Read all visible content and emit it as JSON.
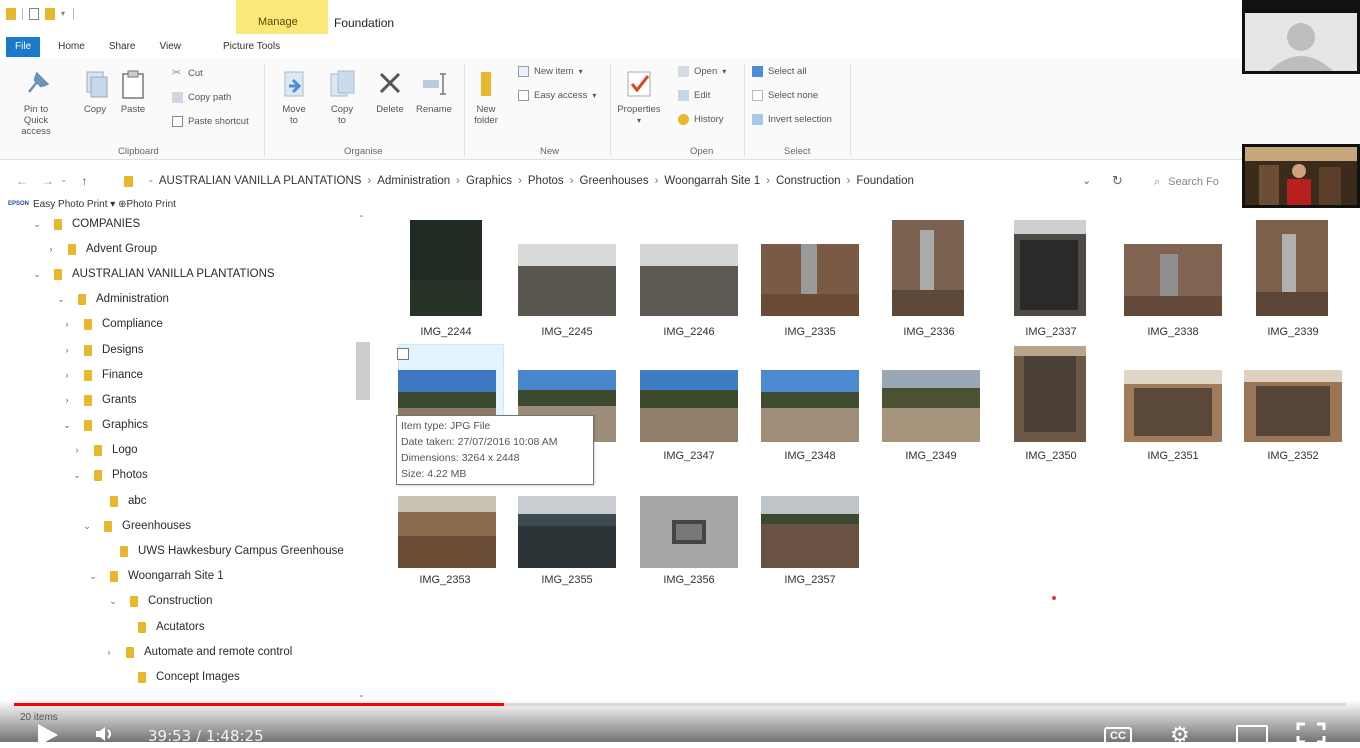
{
  "window": {
    "manage_tab": "Manage",
    "title": "Foundation"
  },
  "tabs": [
    "File",
    "Home",
    "Share",
    "View",
    "Picture Tools"
  ],
  "ribbon": {
    "clipboard": {
      "pin": "Pin to Quick access",
      "copy": "Copy",
      "paste": "Paste",
      "cut": "Cut",
      "copy_path": "Copy path",
      "paste_shortcut": "Paste shortcut",
      "label": "Clipboard"
    },
    "organise": {
      "move_to": "Move to",
      "copy_to": "Copy to",
      "delete": "Delete",
      "rename": "Rename",
      "label": "Organise"
    },
    "new": {
      "new_folder": "New folder",
      "new_item": "New item",
      "easy_access": "Easy access",
      "label": "New"
    },
    "open": {
      "properties": "Properties",
      "open": "Open",
      "edit": "Edit",
      "history": "History",
      "label": "Open"
    },
    "select": {
      "select_all": "Select all",
      "select_none": "Select none",
      "invert": "Invert selection",
      "label": "Select"
    }
  },
  "address": {
    "crumbs": [
      "AUSTRALIAN VANILLA PLANTATIONS",
      "Administration",
      "Graphics",
      "Photos",
      "Greenhouses",
      "Woongarrah Site 1",
      "Construction",
      "Foundation"
    ],
    "search_placeholder": "Search Fo"
  },
  "favorites_bar": {
    "brand": "EPSON",
    "text": "Easy Photo Print ▾ ⊕Photo Print"
  },
  "tree": [
    {
      "label": "COMPANIES",
      "toggle": "⌄"
    },
    {
      "label": "Advent Group",
      "toggle": "›"
    },
    {
      "label": "AUSTRALIAN VANILLA PLANTATIONS",
      "toggle": "⌄"
    },
    {
      "label": "Administration",
      "toggle": "⌄"
    },
    {
      "label": "Compliance",
      "toggle": "›"
    },
    {
      "label": "Designs",
      "toggle": "›"
    },
    {
      "label": "Finance",
      "toggle": "›"
    },
    {
      "label": "Grants",
      "toggle": "›"
    },
    {
      "label": "Graphics",
      "toggle": "⌄"
    },
    {
      "label": "Logo",
      "toggle": "›"
    },
    {
      "label": "Photos",
      "toggle": "⌄"
    },
    {
      "label": "abc",
      "toggle": ""
    },
    {
      "label": "Greenhouses",
      "toggle": "⌄"
    },
    {
      "label": "UWS Hawkesbury Campus Greenhouse",
      "toggle": ""
    },
    {
      "label": "Woongarrah Site 1",
      "toggle": "⌄"
    },
    {
      "label": "Construction",
      "toggle": "⌄"
    },
    {
      "label": "Acutators",
      "toggle": ""
    },
    {
      "label": "Automate and remote control",
      "toggle": "›"
    },
    {
      "label": "Concept Images",
      "toggle": ""
    }
  ],
  "files": [
    {
      "name": "IMG_2244"
    },
    {
      "name": "IMG_2245"
    },
    {
      "name": "IMG_2246"
    },
    {
      "name": "IMG_2335"
    },
    {
      "name": "IMG_2336"
    },
    {
      "name": "IMG_2337"
    },
    {
      "name": "IMG_2338"
    },
    {
      "name": "IMG_2339"
    },
    {
      "name": ""
    },
    {
      "name": ""
    },
    {
      "name": "IMG_2347"
    },
    {
      "name": "IMG_2348"
    },
    {
      "name": "IMG_2349"
    },
    {
      "name": "IMG_2350"
    },
    {
      "name": "IMG_2351"
    },
    {
      "name": "IMG_2352"
    },
    {
      "name": "IMG_2353"
    },
    {
      "name": "IMG_2355"
    },
    {
      "name": "IMG_2356"
    },
    {
      "name": "IMG_2357"
    }
  ],
  "tooltip": {
    "type": "Item type: JPG File",
    "date": "Date taken: 27/07/2016 10:08 AM",
    "dims": "Dimensions: 3264 x 2448",
    "size": "Size: 4.22 MB"
  },
  "status": "20 items",
  "player": {
    "time": "39:53 / 1:48:25",
    "cc": "CC",
    "progress_fraction": 0.368
  },
  "colors": {
    "file_tab": "#1979ca",
    "manage_tab": "#fbe879",
    "folder": "#e8b82c",
    "progress": "#ff0000"
  }
}
